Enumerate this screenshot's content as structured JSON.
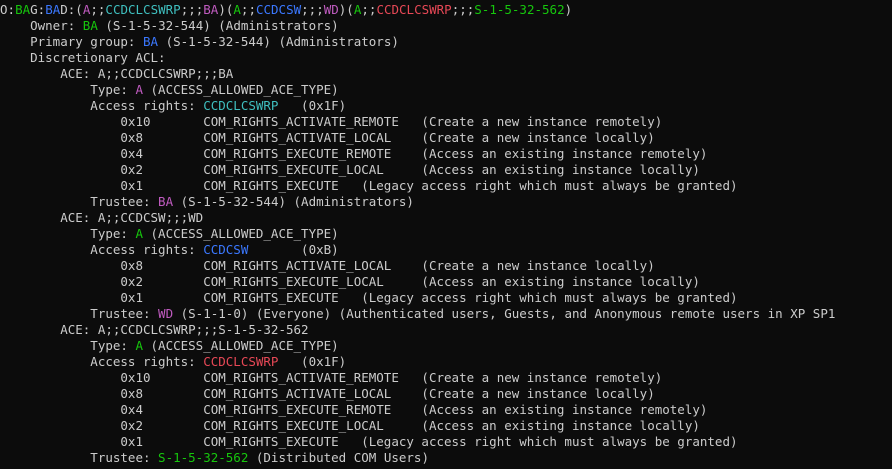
{
  "colors": {
    "background": "#0c0c0c",
    "default": "#cccccc",
    "magenta": "#c05bc0",
    "cyan": "#3a96dd",
    "teal": "#3fbfbf",
    "green": "#16c60c",
    "red": "#e74856",
    "blue": "#3b78ff"
  },
  "lines": [
    [
      [
        "O:",
        "default"
      ],
      [
        "BA",
        "green"
      ],
      [
        "G:",
        "default"
      ],
      [
        "BA",
        "blue"
      ],
      [
        "D:(",
        "default"
      ],
      [
        "A",
        "magenta"
      ],
      [
        ";;",
        "default"
      ],
      [
        "CCDCLCSWRP",
        "teal"
      ],
      [
        ";;;",
        "default"
      ],
      [
        "BA",
        "magenta"
      ],
      [
        ")(",
        "default"
      ],
      [
        "A",
        "green"
      ],
      [
        ";;",
        "default"
      ],
      [
        "CCDCSW",
        "blue"
      ],
      [
        ";;;",
        "default"
      ],
      [
        "WD",
        "magenta"
      ],
      [
        ")(",
        "default"
      ],
      [
        "A",
        "green"
      ],
      [
        ";;",
        "default"
      ],
      [
        "CCDCLCSWRP",
        "red"
      ],
      [
        ";;;",
        "default"
      ],
      [
        "S-1-5-32-562",
        "green"
      ],
      [
        ")",
        "default"
      ]
    ],
    [
      [
        "    Owner: ",
        "default"
      ],
      [
        "BA",
        "green"
      ],
      [
        " (S-1-5-32-544) (Administrators)",
        "default"
      ]
    ],
    [
      [
        "    Primary group: ",
        "default"
      ],
      [
        "BA",
        "blue"
      ],
      [
        " (S-1-5-32-544) (Administrators)",
        "default"
      ]
    ],
    [
      [
        "    Discretionary ACL:",
        "default"
      ]
    ],
    [
      [
        "        ACE: A;;CCDCLCSWRP;;;BA",
        "default"
      ]
    ],
    [
      [
        "            Type: ",
        "default"
      ],
      [
        "A",
        "magenta"
      ],
      [
        " (ACCESS_ALLOWED_ACE_TYPE)",
        "default"
      ]
    ],
    [
      [
        "            Access rights: ",
        "default"
      ],
      [
        "CCDCLCSWRP",
        "teal"
      ],
      [
        "   (0x1F)",
        "default"
      ]
    ],
    [
      [
        "                0x10       COM_RIGHTS_ACTIVATE_REMOTE   (Create a new instance remotely)",
        "default"
      ]
    ],
    [
      [
        "                0x8        COM_RIGHTS_ACTIVATE_LOCAL    (Create a new instance locally)",
        "default"
      ]
    ],
    [
      [
        "                0x4        COM_RIGHTS_EXECUTE_REMOTE    (Access an existing instance remotely)",
        "default"
      ]
    ],
    [
      [
        "                0x2        COM_RIGHTS_EXECUTE_LOCAL     (Access an existing instance locally)",
        "default"
      ]
    ],
    [
      [
        "                0x1        COM_RIGHTS_EXECUTE   (Legacy access right which must always be granted)",
        "default"
      ]
    ],
    [
      [
        "            Trustee: ",
        "default"
      ],
      [
        "BA",
        "magenta"
      ],
      [
        " (S-1-5-32-544) (Administrators)",
        "default"
      ]
    ],
    [
      [
        "        ACE: A;;CCDCSW;;;WD",
        "default"
      ]
    ],
    [
      [
        "            Type: ",
        "default"
      ],
      [
        "A",
        "green"
      ],
      [
        " (ACCESS_ALLOWED_ACE_TYPE)",
        "default"
      ]
    ],
    [
      [
        "            Access rights: ",
        "default"
      ],
      [
        "CCDCSW",
        "blue"
      ],
      [
        "       (0xB)",
        "default"
      ]
    ],
    [
      [
        "                0x8        COM_RIGHTS_ACTIVATE_LOCAL    (Create a new instance locally)",
        "default"
      ]
    ],
    [
      [
        "                0x2        COM_RIGHTS_EXECUTE_LOCAL     (Access an existing instance locally)",
        "default"
      ]
    ],
    [
      [
        "                0x1        COM_RIGHTS_EXECUTE   (Legacy access right which must always be granted)",
        "default"
      ]
    ],
    [
      [
        "            Trustee: ",
        "default"
      ],
      [
        "WD",
        "magenta"
      ],
      [
        " (S-1-1-0) (Everyone) (Authenticated users, Guests, and Anonymous remote users in XP SP1",
        "default"
      ]
    ],
    [
      [
        "        ACE: A;;CCDCLCSWRP;;;S-1-5-32-562",
        "default"
      ]
    ],
    [
      [
        "            Type: ",
        "default"
      ],
      [
        "A",
        "green"
      ],
      [
        " (ACCESS_ALLOWED_ACE_TYPE)",
        "default"
      ]
    ],
    [
      [
        "            Access rights: ",
        "default"
      ],
      [
        "CCDCLCSWRP",
        "red"
      ],
      [
        "   (0x1F)",
        "default"
      ]
    ],
    [
      [
        "                0x10       COM_RIGHTS_ACTIVATE_REMOTE   (Create a new instance remotely)",
        "default"
      ]
    ],
    [
      [
        "                0x8        COM_RIGHTS_ACTIVATE_LOCAL    (Create a new instance locally)",
        "default"
      ]
    ],
    [
      [
        "                0x4        COM_RIGHTS_EXECUTE_REMOTE    (Access an existing instance remotely)",
        "default"
      ]
    ],
    [
      [
        "                0x2        COM_RIGHTS_EXECUTE_LOCAL     (Access an existing instance locally)",
        "default"
      ]
    ],
    [
      [
        "                0x1        COM_RIGHTS_EXECUTE   (Legacy access right which must always be granted)",
        "default"
      ]
    ],
    [
      [
        "            Trustee: ",
        "default"
      ],
      [
        "S-1-5-32-562",
        "green"
      ],
      [
        " (Distributed COM Users)",
        "default"
      ]
    ]
  ]
}
